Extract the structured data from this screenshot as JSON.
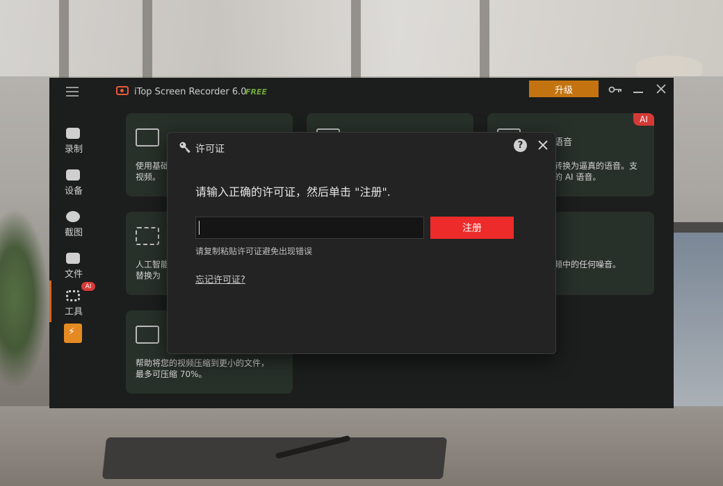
{
  "app": {
    "title": "iTop Screen Recorder 6.0",
    "edition_badge": "FREE",
    "upgrade_label": "升级"
  },
  "sidebar": {
    "items": [
      {
        "label": "录制",
        "icon": "record-icon"
      },
      {
        "label": "设备",
        "icon": "device-icon"
      },
      {
        "label": "截图",
        "icon": "camera-icon"
      },
      {
        "label": "文件",
        "icon": "folder-icon"
      },
      {
        "label": "工具",
        "icon": "tools-icon",
        "badge": "AI"
      }
    ]
  },
  "cards": [
    {
      "desc": "使用基础\n视频。",
      "icon": "video-edit-icon"
    },
    {
      "desc": "",
      "icon": "film-icon"
    },
    {
      "title": "语音",
      "desc": "转换为逼真的语音。支\n的 AI 语音。",
      "icon": "voice-icon",
      "badge": "AI"
    },
    {
      "desc": "人工智能\n替换为",
      "icon": "ai-background-icon"
    },
    {
      "desc": "频中的任何噪音。",
      "icon": "noise-icon"
    },
    {
      "desc": "帮助将您的视频压缩到更小的文件，\n最多可压缩 70%。",
      "icon": "compress-icon"
    }
  ],
  "modal": {
    "title": "许可证",
    "prompt": "请输入正确的许可证，然后单击 \"注册\".",
    "input_value": "",
    "register_label": "注册",
    "hint": "请复制粘贴许可证避免出现错误",
    "forgot_link": "忘记许可证?"
  },
  "colors": {
    "accent_orange": "#c37411",
    "register_red": "#ee2b2b",
    "ai_badge_red": "#d63a36",
    "free_green": "#6ea83a"
  }
}
